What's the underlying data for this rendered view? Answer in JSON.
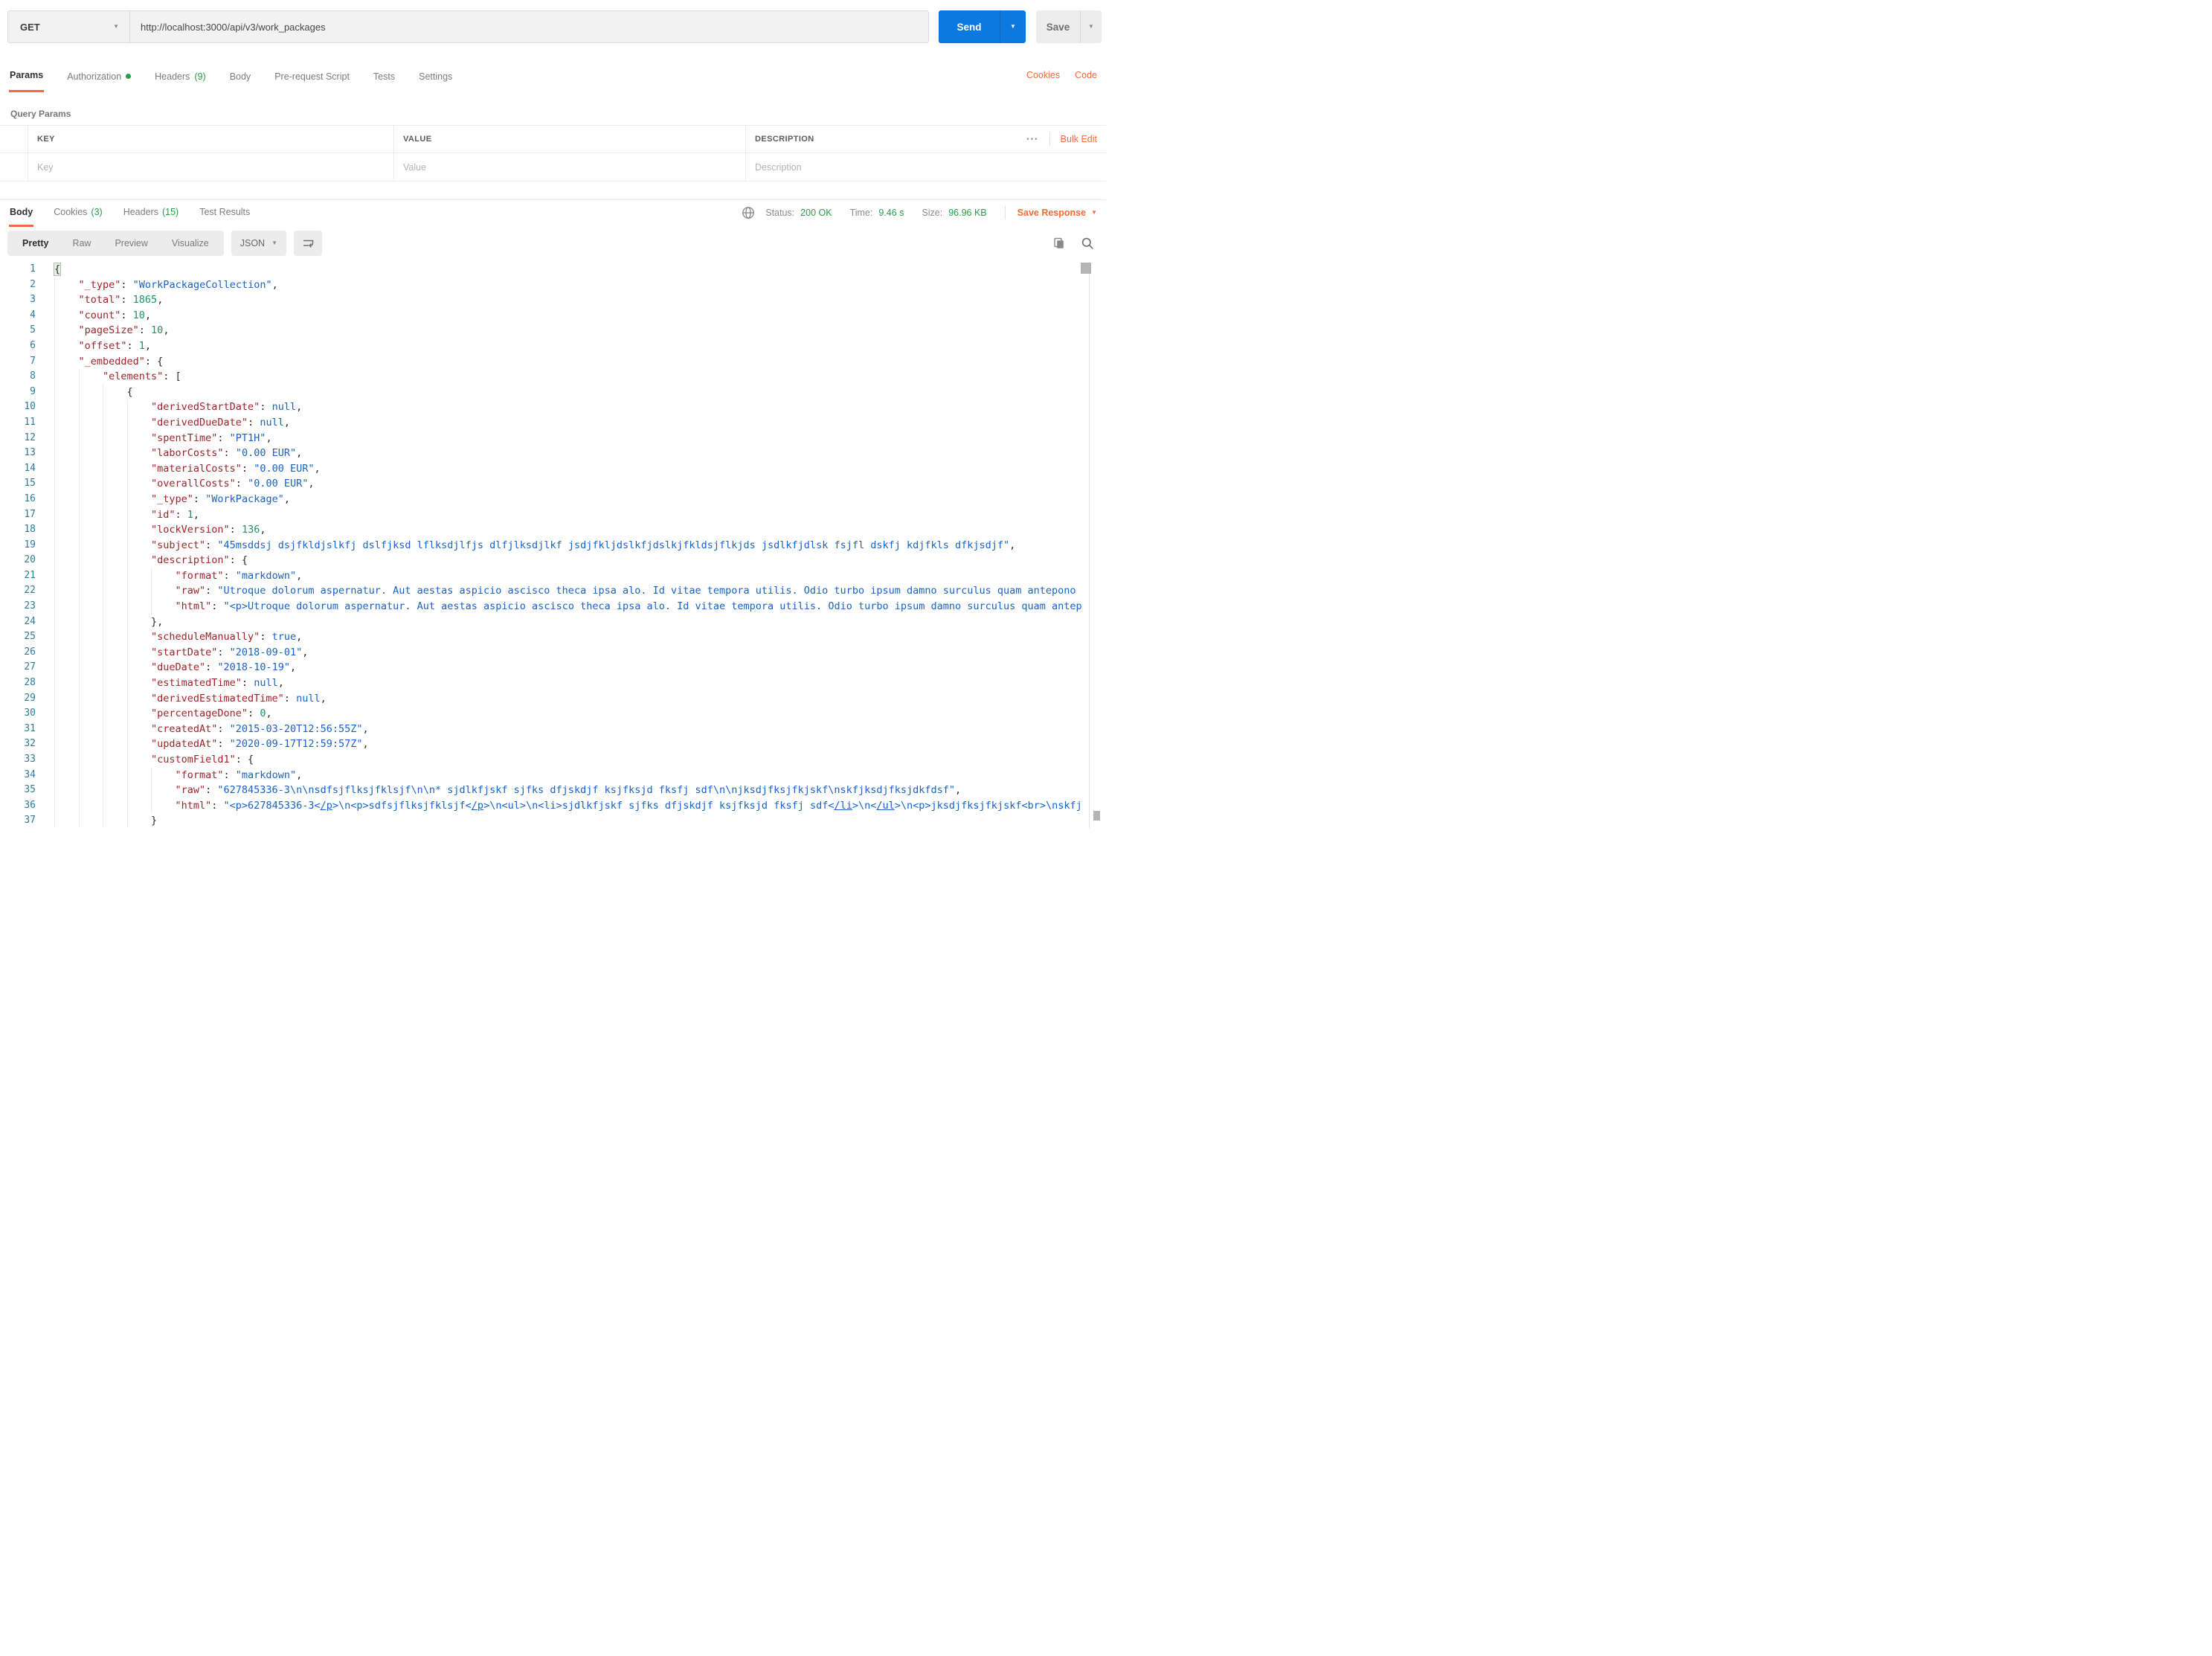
{
  "colors": {
    "accent_orange": "#F26B3A",
    "primary_blue": "#0B79E0",
    "success_green": "#26A148",
    "json_key": "#9E2428",
    "json_string": "#1862C8",
    "json_number": "#1A965F",
    "line_number_teal": "#2D7B9B"
  },
  "request": {
    "method": "GET",
    "url": "http://localhost:3000/api/v3/work_packages",
    "send_label": "Send",
    "save_label": "Save"
  },
  "request_tabs": {
    "params": "Params",
    "authorization": "Authorization",
    "headers": "Headers",
    "headers_count": "(9)",
    "body": "Body",
    "pre_request": "Pre-request Script",
    "tests": "Tests",
    "settings": "Settings"
  },
  "links": {
    "cookies": "Cookies",
    "code": "Code"
  },
  "query_params": {
    "title": "Query Params",
    "col_key": "KEY",
    "col_value": "VALUE",
    "col_description": "DESCRIPTION",
    "ph_key": "Key",
    "ph_value": "Value",
    "ph_description": "Description",
    "menu_dots": "•••",
    "bulk_edit": "Bulk Edit"
  },
  "response_tabs": {
    "body": "Body",
    "cookies": "Cookies",
    "cookies_count": "(3)",
    "headers": "Headers",
    "headers_count": "(15)",
    "test_results": "Test Results"
  },
  "status_bar": {
    "status_label": "Status:",
    "status_value": "200 OK",
    "time_label": "Time:",
    "time_value": "9.46 s",
    "size_label": "Size:",
    "size_value": "96.96 KB",
    "save_response": "Save Response"
  },
  "viewer": {
    "modes": [
      "Pretty",
      "Raw",
      "Preview",
      "Visualize"
    ],
    "active_mode": "Pretty",
    "format": "JSON"
  },
  "code": {
    "lines": [
      {
        "i": 0,
        "t": [
          [
            "b",
            "{"
          ]
        ]
      },
      {
        "i": 1,
        "t": [
          [
            "k",
            "\"_type\""
          ],
          [
            "p",
            ": "
          ],
          [
            "s",
            "\"WorkPackageCollection\""
          ],
          [
            "p",
            ","
          ]
        ]
      },
      {
        "i": 1,
        "t": [
          [
            "k",
            "\"total\""
          ],
          [
            "p",
            ": "
          ],
          [
            "n",
            "1865"
          ],
          [
            "p",
            ","
          ]
        ]
      },
      {
        "i": 1,
        "t": [
          [
            "k",
            "\"count\""
          ],
          [
            "p",
            ": "
          ],
          [
            "n",
            "10"
          ],
          [
            "p",
            ","
          ]
        ]
      },
      {
        "i": 1,
        "t": [
          [
            "k",
            "\"pageSize\""
          ],
          [
            "p",
            ": "
          ],
          [
            "n",
            "10"
          ],
          [
            "p",
            ","
          ]
        ]
      },
      {
        "i": 1,
        "t": [
          [
            "k",
            "\"offset\""
          ],
          [
            "p",
            ": "
          ],
          [
            "n",
            "1"
          ],
          [
            "p",
            ","
          ]
        ]
      },
      {
        "i": 1,
        "t": [
          [
            "k",
            "\"_embedded\""
          ],
          [
            "p",
            ": {"
          ]
        ]
      },
      {
        "i": 2,
        "t": [
          [
            "k",
            "\"elements\""
          ],
          [
            "p",
            ": ["
          ]
        ]
      },
      {
        "i": 3,
        "t": [
          [
            "p",
            "{"
          ]
        ]
      },
      {
        "i": 4,
        "t": [
          [
            "k",
            "\"derivedStartDate\""
          ],
          [
            "p",
            ": "
          ],
          [
            "a",
            "null"
          ],
          [
            "p",
            ","
          ]
        ]
      },
      {
        "i": 4,
        "t": [
          [
            "k",
            "\"derivedDueDate\""
          ],
          [
            "p",
            ": "
          ],
          [
            "a",
            "null"
          ],
          [
            "p",
            ","
          ]
        ]
      },
      {
        "i": 4,
        "t": [
          [
            "k",
            "\"spentTime\""
          ],
          [
            "p",
            ": "
          ],
          [
            "s",
            "\"PT1H\""
          ],
          [
            "p",
            ","
          ]
        ]
      },
      {
        "i": 4,
        "t": [
          [
            "k",
            "\"laborCosts\""
          ],
          [
            "p",
            ": "
          ],
          [
            "s",
            "\"0.00 EUR\""
          ],
          [
            "p",
            ","
          ]
        ]
      },
      {
        "i": 4,
        "t": [
          [
            "k",
            "\"materialCosts\""
          ],
          [
            "p",
            ": "
          ],
          [
            "s",
            "\"0.00 EUR\""
          ],
          [
            "p",
            ","
          ]
        ]
      },
      {
        "i": 4,
        "t": [
          [
            "k",
            "\"overallCosts\""
          ],
          [
            "p",
            ": "
          ],
          [
            "s",
            "\"0.00 EUR\""
          ],
          [
            "p",
            ","
          ]
        ]
      },
      {
        "i": 4,
        "t": [
          [
            "k",
            "\"_type\""
          ],
          [
            "p",
            ": "
          ],
          [
            "s",
            "\"WorkPackage\""
          ],
          [
            "p",
            ","
          ]
        ]
      },
      {
        "i": 4,
        "t": [
          [
            "k",
            "\"id\""
          ],
          [
            "p",
            ": "
          ],
          [
            "n",
            "1"
          ],
          [
            "p",
            ","
          ]
        ]
      },
      {
        "i": 4,
        "t": [
          [
            "k",
            "\"lockVersion\""
          ],
          [
            "p",
            ": "
          ],
          [
            "n",
            "136"
          ],
          [
            "p",
            ","
          ]
        ]
      },
      {
        "i": 4,
        "t": [
          [
            "k",
            "\"subject\""
          ],
          [
            "p",
            ": "
          ],
          [
            "s",
            "\"45msddsj dsjfkldjslkfj dslfjksd lflksdjlfjs dlfjlksdjlkf jsdjfkljdslkfjdslkjfkldsjflkjds jsdlkfjdlsk fsjfl dskfj kdjfkls dfkjsdjf\""
          ],
          [
            "p",
            ","
          ]
        ]
      },
      {
        "i": 4,
        "t": [
          [
            "k",
            "\"description\""
          ],
          [
            "p",
            ": {"
          ]
        ]
      },
      {
        "i": 5,
        "t": [
          [
            "k",
            "\"format\""
          ],
          [
            "p",
            ": "
          ],
          [
            "s",
            "\"markdown\""
          ],
          [
            "p",
            ","
          ]
        ]
      },
      {
        "i": 5,
        "t": [
          [
            "k",
            "\"raw\""
          ],
          [
            "p",
            ": "
          ],
          [
            "s",
            "\"Utroque dolorum aspernatur. Aut aestas aspicio ascisco theca ipsa alo. Id vitae tempora utilis. Odio turbo ipsum damno surculus quam antepono"
          ]
        ]
      },
      {
        "i": 5,
        "t": [
          [
            "k",
            "\"html\""
          ],
          [
            "p",
            ": "
          ],
          [
            "s",
            "\"<p>Utroque dolorum aspernatur. Aut aestas aspicio ascisco theca ipsa alo. Id vitae tempora utilis. Odio turbo ipsum damno surculus quam antep"
          ]
        ]
      },
      {
        "i": 4,
        "t": [
          [
            "p",
            "},"
          ]
        ]
      },
      {
        "i": 4,
        "t": [
          [
            "k",
            "\"scheduleManually\""
          ],
          [
            "p",
            ": "
          ],
          [
            "a",
            "true"
          ],
          [
            "p",
            ","
          ]
        ]
      },
      {
        "i": 4,
        "t": [
          [
            "k",
            "\"startDate\""
          ],
          [
            "p",
            ": "
          ],
          [
            "s",
            "\"2018-09-01\""
          ],
          [
            "p",
            ","
          ]
        ]
      },
      {
        "i": 4,
        "t": [
          [
            "k",
            "\"dueDate\""
          ],
          [
            "p",
            ": "
          ],
          [
            "s",
            "\"2018-10-19\""
          ],
          [
            "p",
            ","
          ]
        ]
      },
      {
        "i": 4,
        "t": [
          [
            "k",
            "\"estimatedTime\""
          ],
          [
            "p",
            ": "
          ],
          [
            "a",
            "null"
          ],
          [
            "p",
            ","
          ]
        ]
      },
      {
        "i": 4,
        "t": [
          [
            "k",
            "\"derivedEstimatedTime\""
          ],
          [
            "p",
            ": "
          ],
          [
            "a",
            "null"
          ],
          [
            "p",
            ","
          ]
        ]
      },
      {
        "i": 4,
        "t": [
          [
            "k",
            "\"percentageDone\""
          ],
          [
            "p",
            ": "
          ],
          [
            "n",
            "0"
          ],
          [
            "p",
            ","
          ]
        ]
      },
      {
        "i": 4,
        "t": [
          [
            "k",
            "\"createdAt\""
          ],
          [
            "p",
            ": "
          ],
          [
            "s",
            "\"2015-03-20T12:56:55Z\""
          ],
          [
            "p",
            ","
          ]
        ]
      },
      {
        "i": 4,
        "t": [
          [
            "k",
            "\"updatedAt\""
          ],
          [
            "p",
            ": "
          ],
          [
            "s",
            "\"2020-09-17T12:59:57Z\""
          ],
          [
            "p",
            ","
          ]
        ]
      },
      {
        "i": 4,
        "t": [
          [
            "k",
            "\"customField1\""
          ],
          [
            "p",
            ": {"
          ]
        ]
      },
      {
        "i": 5,
        "t": [
          [
            "k",
            "\"format\""
          ],
          [
            "p",
            ": "
          ],
          [
            "s",
            "\"markdown\""
          ],
          [
            "p",
            ","
          ]
        ]
      },
      {
        "i": 5,
        "t": [
          [
            "k",
            "\"raw\""
          ],
          [
            "p",
            ": "
          ],
          [
            "s",
            "\"627845336-3\\n\\nsdfsjflksjfklsjf\\n\\n* sjdlkfjskf sjfks dfjskdjf ksjfksjd fksfj sdf\\n\\njksdjfksjfkjskf\\nskfjksdjfksjdkfdsf\""
          ],
          [
            "p",
            ","
          ]
        ]
      },
      {
        "i": 5,
        "t": [
          [
            "k",
            "\"html\""
          ],
          [
            "p",
            ": "
          ],
          [
            "s",
            "\"<p>627845336-3<"
          ],
          [
            "sl",
            "/p"
          ],
          [
            "s",
            ">\\n<p>sdfsjflksjfklsjf<"
          ],
          [
            "sl",
            "/p"
          ],
          [
            "s",
            ">\\n<ul>\\n<li>sjdlkfjskf sjfks dfjskdjf ksjfksjd fksfj sdf<"
          ],
          [
            "sl",
            "/li"
          ],
          [
            "s",
            ">\\n<"
          ],
          [
            "sl",
            "/ul"
          ],
          [
            "s",
            ">\\n<p>jksdjfksjfkjskf<br>\\nskfj"
          ]
        ]
      },
      {
        "i": 4,
        "t": [
          [
            "p",
            "}"
          ]
        ]
      }
    ]
  }
}
